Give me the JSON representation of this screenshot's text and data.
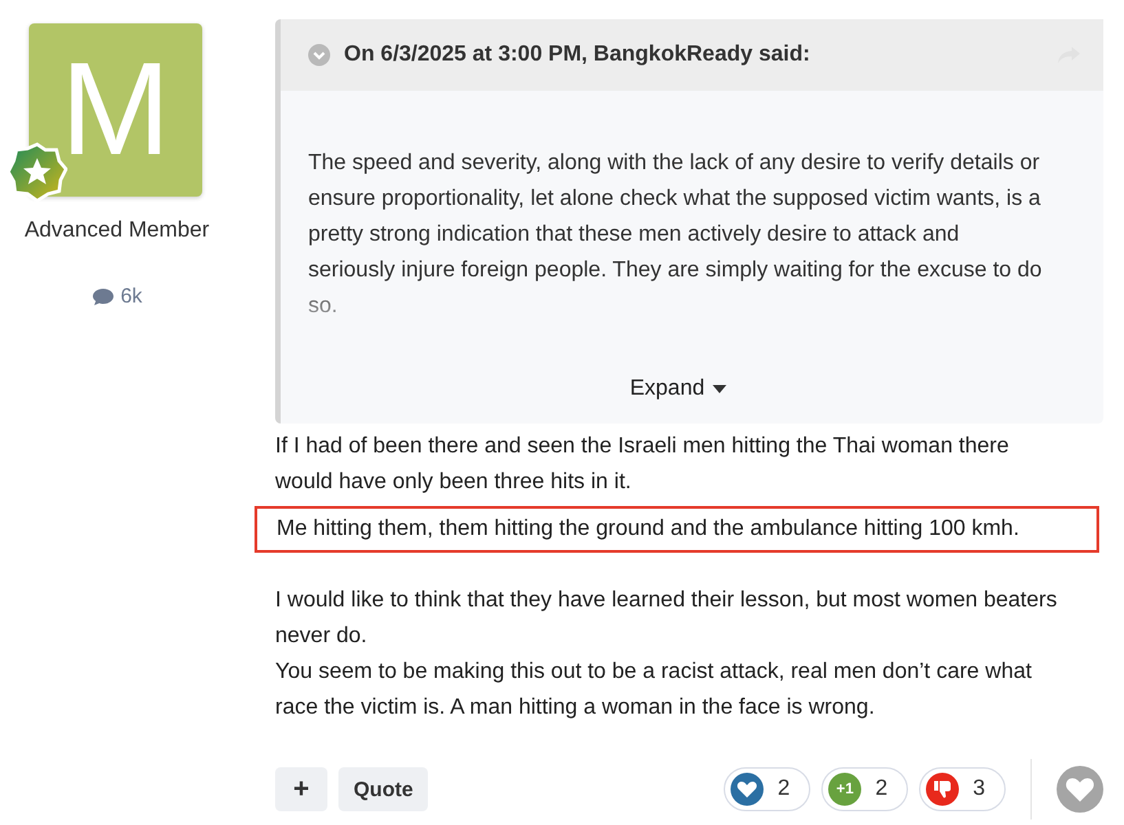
{
  "author": {
    "avatar_letter": "M",
    "title": "Advanced Member",
    "post_count": "6k"
  },
  "quote": {
    "attribution": "On 6/3/2025 at 3:00 PM, BangkokReady said:",
    "text": "The speed and severity, along with the lack of any desire to verify details or ensure proportionality, let alone check what the supposed victim wants, is a pretty strong indication that these men actively desire to attack and seriously injure foreign people.  They are simply waiting for the excuse to do so.",
    "expand_label": "Expand"
  },
  "body": [
    [
      {
        "text": "If I had of been there and seen the Israeli men hitting the Thai woman there would have only been three hits in it.",
        "highlighted": false
      },
      {
        "text": "Me hitting them, them hitting the ground and the ambulance hitting 100 kmh.",
        "highlighted": true
      }
    ],
    [
      {
        "text": "I would like to think that they have learned their lesson, but most women beaters never do.",
        "highlighted": false
      },
      {
        "text": "You seem to be making this out to be a racist attack, real men don’t care what race the victim is. A man hitting a woman in the face is wrong.",
        "highlighted": false
      }
    ]
  ],
  "actions": {
    "add_label": "+",
    "quote_label": "Quote"
  },
  "reactions": [
    {
      "kind": "like",
      "count": "2"
    },
    {
      "kind": "plusone",
      "label": "+1",
      "count": "2"
    },
    {
      "kind": "dislike",
      "count": "3"
    }
  ]
}
